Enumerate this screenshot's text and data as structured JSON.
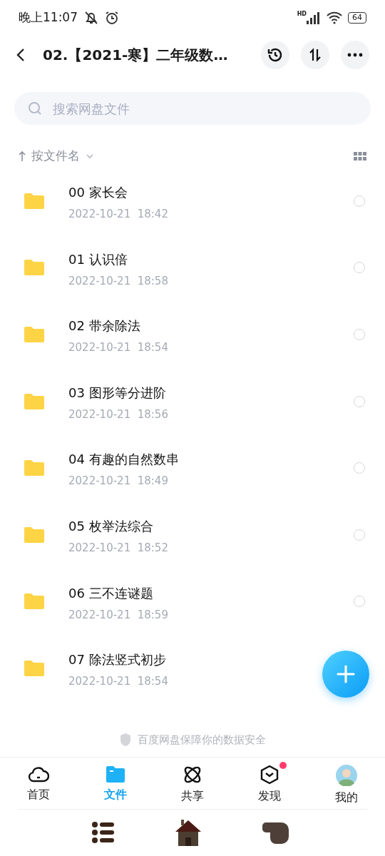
{
  "status_bar": {
    "time": "晚上11:07",
    "network": "HD",
    "battery": "64"
  },
  "header": {
    "title": "02.【2021-寒】二年级数…"
  },
  "search": {
    "placeholder": "搜索网盘文件"
  },
  "sort": {
    "label": "按文件名"
  },
  "files": [
    {
      "name": "00 家长会",
      "date": "2022-10-21  18:42",
      "selected": false
    },
    {
      "name": "01 认识倍",
      "date": "2022-10-21  18:58",
      "selected": false
    },
    {
      "name": "02 带余除法",
      "date": "2022-10-21  18:54",
      "selected": false
    },
    {
      "name": "03 图形等分进阶",
      "date": "2022-10-21  18:56",
      "selected": false
    },
    {
      "name": "04 有趣的自然数串",
      "date": "2022-10-21  18:49",
      "selected": false
    },
    {
      "name": "05 枚举法综合",
      "date": "2022-10-21  18:52",
      "selected": false
    },
    {
      "name": "06 三不连谜题",
      "date": "2022-10-21  18:59",
      "selected": false
    },
    {
      "name": "07 除法竖式初步",
      "date": "2022-10-21  18:54"
    }
  ],
  "footer_note": "百度网盘保障你的数据安全",
  "tabs": [
    {
      "kind": "home",
      "label": "首页",
      "selected": false,
      "dot": false
    },
    {
      "kind": "files",
      "label": "文件",
      "selected": true,
      "dot": false
    },
    {
      "kind": "share",
      "label": "共享",
      "selected": false,
      "dot": false
    },
    {
      "kind": "discover",
      "label": "发现",
      "selected": false,
      "dot": true
    },
    {
      "kind": "me",
      "label": "我的",
      "selected": false,
      "dot": false
    }
  ]
}
